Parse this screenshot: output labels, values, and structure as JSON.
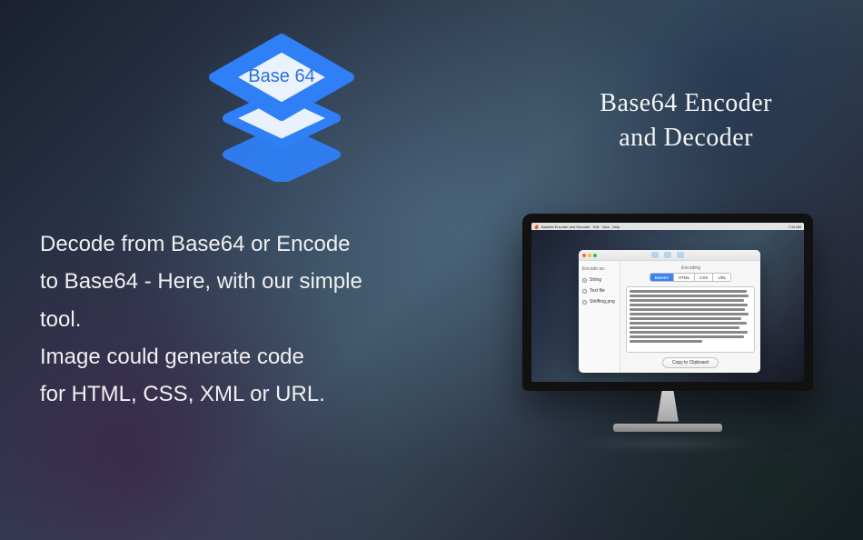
{
  "logo": {
    "label": "Base 64"
  },
  "title": {
    "line1": "Base64 Encoder",
    "line2": "and Decoder"
  },
  "description": {
    "line1": "Decode from Base64 or Encode",
    "line2": "to Base64 - Here, with our simple",
    "line3": "tool.",
    "line4": "Image could generate code",
    "line5": "for HTML, CSS, XML or URL."
  },
  "menubar": {
    "app": "Base64 Encoder and Decoder",
    "items": [
      "Edit",
      "View",
      "Help"
    ],
    "clock": "7:44 AM"
  },
  "app": {
    "sidebar": {
      "header": "Encode as:",
      "options": [
        "String",
        "Text file",
        "Stri/fling,png"
      ],
      "selectedIndex": 0
    },
    "main": {
      "seg_label": "Encoding",
      "segs": [
        "Base64",
        "HTML",
        "CSS",
        "URL"
      ],
      "selectedSeg": 0,
      "copy_label": "Copy to Clipboard"
    }
  }
}
